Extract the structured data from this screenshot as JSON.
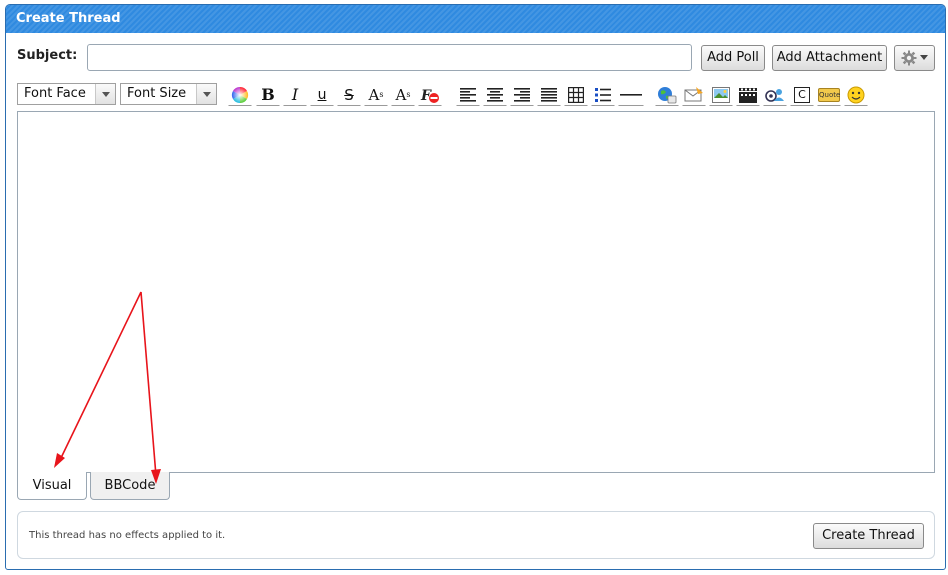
{
  "window": {
    "title": "Create Thread"
  },
  "form": {
    "subject_label": "Subject:",
    "subject_value": "",
    "add_poll": "Add Poll",
    "add_attachment": "Add Attachment",
    "options_icon": "gear-icon"
  },
  "toolbar": {
    "font_face": "Font Face",
    "font_size": "Font Size",
    "bold": "B",
    "italic": "I",
    "underline": "u",
    "strike": "S",
    "superscript": "A",
    "subscript": "A",
    "buttons": [
      {
        "name": "color",
        "icon": "color-wheel-icon"
      },
      {
        "name": "remove-format",
        "icon": "remove-format-icon"
      },
      {
        "name": "align-left",
        "icon": "align-left-icon"
      },
      {
        "name": "align-center",
        "icon": "align-center-icon"
      },
      {
        "name": "align-right",
        "icon": "align-right-icon"
      },
      {
        "name": "justify",
        "icon": "justify-icon"
      },
      {
        "name": "table",
        "icon": "table-icon"
      },
      {
        "name": "bullet-list",
        "icon": "bullet-list-icon"
      },
      {
        "name": "horizontal-rule",
        "icon": "horizontal-rule-icon"
      },
      {
        "name": "link",
        "icon": "link-globe-icon"
      },
      {
        "name": "email",
        "icon": "email-icon"
      },
      {
        "name": "image",
        "icon": "image-icon"
      },
      {
        "name": "video",
        "icon": "video-icon"
      },
      {
        "name": "mention",
        "icon": "mention-icon"
      },
      {
        "name": "code",
        "icon": "code-icon"
      },
      {
        "name": "quote",
        "icon": "quote-icon"
      },
      {
        "name": "smilie",
        "icon": "smilie-icon"
      }
    ],
    "code_glyph": "C",
    "quote_glyph": "Quote"
  },
  "editor": {
    "tabs": [
      {
        "label": "Visual",
        "active": true
      },
      {
        "label": "BBCode",
        "active": false
      }
    ]
  },
  "footer": {
    "effects_text": "This thread has no effects applied to it.",
    "create_button": "Create Thread"
  },
  "colors": {
    "title_bar": "#2f8ae0",
    "annotation_arrow": "#e8141b"
  }
}
